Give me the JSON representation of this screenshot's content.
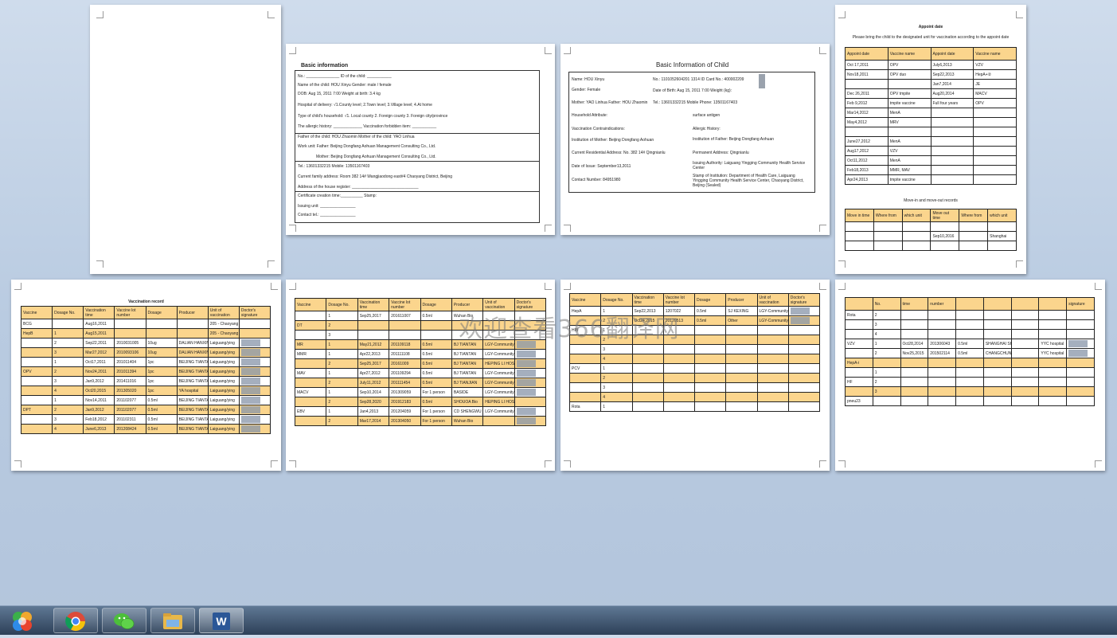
{
  "watermark": "欢迎查看366翻译网",
  "page2": {
    "title": "Basic information",
    "lines": [
      "No.: _______________            ID of the child: ___________",
      "Name of the child:  HOU Xinyu        Gender: male / female",
      "DOB: Aug 15, 2011    7:00             Weight at birth: 3.4 kg",
      "Hospital of delivery: √1.County level; 2.Town level; 3.Village level; 4.At home",
      "Type of child's household: √1. Local county 2. Foreign county 3. Foreign city/province",
      "The allergic history: _____________   Vaccination forbidden item: ___________",
      "Father of the child: HOU Zhaomin            Mother of the child: YAO Linhua",
      "Work unit: Father: Beijing Dongfang Aohuan Management Consulting Co., Ltd.",
      "Mother: Beijing Dongfang Aohuan Management Consulting Co., Ltd.",
      "Tel.: 13601332215                Mobile: 13501167403",
      "Current family address: Room 382 14# Wangjiaodong east#4 Chaoyang District, Beijing",
      "Address of the house register: ______________________________",
      "Certificate creation time:__________          Stamp:",
      "Issuing unit: ________________",
      "Contact tel.: ________________"
    ]
  },
  "page3": {
    "title": "Basic Information of Child",
    "lines_left": [
      "Name: HOU Xinyu",
      "Gender: Female",
      "Mother: YAO Linhua        Father: HOU Zhaomin",
      "Household Attribute:",
      "Vaccination Contraindications:",
      "Institution of Mother: Beijing Dongfang Aohuan",
      "Current Residential Address: No. 382 14# Qingnianlu",
      "Date of Issue: September13,2011",
      "Contact Number: 84951980"
    ],
    "lines_right": [
      "No.: 1101052604201 1314          ID Card No.:  400002209",
      "Date of Birth: Aug 15, 2011   7:00      Weight (kg):",
      "Tel.: 13601332215                 Mobile Phone: 13501167403",
      "surface antigen",
      "Allergic History:",
      "Institution of Father: Beijing Dongfang Aohuan",
      "Permanent Address: Qingnianlu",
      "Issuing Authority: Laiguang Yingging Community Health Service Center",
      "Stamp of Institution: Department of Health Care, Laiguang Yingging Community Health Service Center, Chaoyang District, Beijing (Sealed)"
    ]
  },
  "page4": {
    "title": "Appoint date",
    "subtitle": "Please bring the child to the designated unit for vaccination according to the appoint date",
    "headers": [
      "Appoint date",
      "Vaccine name",
      "Appoint date",
      "Vaccine name"
    ],
    "rows": [
      [
        "Oct 17,2011",
        "OPV",
        "July6,2013",
        "VZV"
      ],
      [
        "Nov18,2011",
        "OPV duo",
        "Sep22,2013",
        "HepA+②"
      ],
      [
        "",
        "",
        "Jan7,2014",
        "JE"
      ],
      [
        "Dec 26,2011",
        "OPV tmpite",
        "Aug20,2014",
        "MACV"
      ],
      [
        "Feb 9,2012",
        "tmpite vaccine",
        "Full four years",
        "OPV"
      ],
      [
        "Mar14,2012",
        "MenA",
        "",
        ""
      ],
      [
        "May4,2012",
        "MRV",
        "",
        ""
      ],
      [
        "",
        "",
        "",
        ""
      ],
      [
        "June27,2012",
        "MenA",
        "",
        ""
      ],
      [
        "Aug17,2012",
        "VZV",
        "",
        ""
      ],
      [
        "Oct11,2012",
        "MenA",
        "",
        ""
      ],
      [
        "Feb18,2013",
        "MMR, MAV",
        "",
        ""
      ],
      [
        "Apr24,2013",
        "tmpite vaccine",
        "",
        ""
      ]
    ],
    "move_title": "Move-in and move-out records",
    "move_headers": [
      "Move in time",
      "Where from",
      "which unit",
      "Move out time",
      "Where from",
      "which unit"
    ],
    "move_rows": [
      [
        "",
        "",
        "",
        "",
        "",
        ""
      ],
      [
        "",
        "",
        "",
        "Sep10,2016",
        "",
        "Shanghai"
      ],
      [
        "",
        "",
        "",
        "",
        "",
        ""
      ]
    ]
  },
  "page5": {
    "title": "Vaccination record",
    "headers": [
      "Vaccine",
      "Dosage No.",
      "Vaccination time",
      "Vaccine lot number",
      "Dosage",
      "Producer",
      "Unit of vaccination",
      "Doctor's signature"
    ],
    "rows": [
      [
        "BCG",
        "",
        "Aug16,2011",
        "",
        "",
        "",
        "205 - Chaoyang",
        "",
        ""
      ],
      [
        "HepB",
        "1",
        "Aug15,2011",
        "",
        "",
        "",
        "205 - Chaoyang",
        "",
        "hl"
      ],
      [
        "",
        "2",
        "Sep22,2011",
        "2010031005",
        "10ug",
        "DALIAN HANXIN",
        "Laiguang/ying",
        "sig",
        ""
      ],
      [
        "",
        "3",
        "Mar27,2012",
        "2010093106",
        "10ug",
        "DALIAN HANXIN",
        "Laiguang/ying",
        "sig",
        "hl"
      ],
      [
        "",
        "1",
        "Oct17,2011",
        "201011404",
        "1pc",
        "BEIJING TIANTAN",
        "Laiguang/ying",
        "sig",
        ""
      ],
      [
        "OPV",
        "2",
        "Nov24,2011",
        "201011394",
        "1pc",
        "BEIJING TIANTAN",
        "Laiguang/ying",
        "sig",
        "hl"
      ],
      [
        "",
        "3",
        "Jan9,2012",
        "201411016",
        "1pc",
        "BEIJING TIANTAN",
        "Laiguang/ying",
        "sig",
        ""
      ],
      [
        "",
        "4",
        "Oct20,2015",
        "201305020",
        "1pc",
        "YA hospital",
        "Laiguang/ying",
        "sig",
        "hl"
      ],
      [
        "",
        "1",
        "Nov14,2011",
        "201102077",
        "0.5ml",
        "BEIJING TIANTAN",
        "Laiguang/ying",
        "sig",
        ""
      ],
      [
        "DPT",
        "2",
        "Jan9,2012",
        "201102077",
        "0.5ml",
        "BEIJING TIANTAN",
        "Laiguang/ying",
        "sig",
        "hl"
      ],
      [
        "",
        "3",
        "Feb18,2012",
        "201102311",
        "0.5ml",
        "BEIJING TIANTAN",
        "Laiguang/ying",
        "sig",
        ""
      ],
      [
        "",
        "4",
        "June6,2013",
        "201208424",
        "0.5ml",
        "BEIJING TIANTAN",
        "Laiguang/ying",
        "sig",
        "hl"
      ]
    ]
  },
  "page6": {
    "headers": [
      "Vaccine",
      "Dosage No.",
      "Vaccination time",
      "Vaccine lot number",
      "Dosage",
      "Producer",
      "Unit of vaccination",
      "Doctor's signature"
    ],
    "rows": [
      [
        "",
        "1",
        "Sep25,2017",
        "201611007",
        "0.5ml",
        "Wuhan Bio",
        "",
        "",
        ""
      ],
      [
        "DT",
        "2",
        "",
        "",
        "",
        "",
        "",
        "",
        "hl"
      ],
      [
        "",
        "3",
        "",
        "",
        "",
        "",
        "",
        "",
        ""
      ],
      [
        "MR",
        "1",
        "May21,2012",
        "201109118",
        "0.5ml",
        "BJ TIANTAN",
        "LGY-Community",
        "sig",
        "hl"
      ],
      [
        "MMR",
        "1",
        "Apr22,2013",
        "201111108",
        "0.5ml",
        "BJ TIANTAN",
        "LGY-Community",
        "sig",
        ""
      ],
      [
        "",
        "2",
        "Sep25,2017",
        "20161009",
        "0.5ml",
        "BJ TIANTAN",
        "HEPING LI HOSPITAL",
        "sig",
        "hl"
      ],
      [
        "MAV",
        "1",
        "Apr27,2012",
        "201109294",
        "0.5ml",
        "BJ TIANTAN",
        "LGY-Community",
        "sig",
        ""
      ],
      [
        "",
        "2",
        "July11,2012",
        "201111454",
        "0.5ml",
        "BJ TIANJIAN",
        "LGY-Community",
        "sig",
        "hl"
      ],
      [
        "MACV",
        "1",
        "Sep10,2014",
        "201309059",
        "For 1 person",
        "BASIDE",
        "LGY-Community",
        "sig",
        ""
      ],
      [
        "",
        "2",
        "Sep28,2020",
        "201912183",
        "0.5ml",
        "SHOUOA Bio",
        "HEPING LI HOSPITAL",
        "",
        "hl"
      ],
      [
        "EBV",
        "1",
        "Jan4,2013",
        "201204059",
        "For 1 person",
        "CD SHENGWU",
        "LGY-Community",
        "sig",
        ""
      ],
      [
        "",
        "2",
        "Mar17,2014",
        "201304050",
        "For 1 person",
        "Wuhan Bio",
        "",
        "sig",
        "hl"
      ]
    ]
  },
  "page7": {
    "headers": [
      "Vaccine",
      "Dosage No.",
      "Vaccination time",
      "Vaccine lot number",
      "Dosage",
      "Producer",
      "Unit of vaccination",
      "Doctor's signature"
    ],
    "rows": [
      [
        "HepA",
        "1",
        "Sep22,2013",
        "1207022",
        "0.5ml",
        "SJ KEXING",
        "LGY-Community",
        "sig",
        ""
      ],
      [
        "",
        "2",
        "Oct24,2015",
        "20120513",
        "0.5ml",
        "Other",
        "LGY-Community",
        "sig",
        "hl"
      ],
      [
        "HIB",
        "1",
        "",
        "",
        "",
        "",
        "",
        "",
        ""
      ],
      [
        "",
        "2",
        "",
        "",
        "",
        "",
        "",
        "",
        "hl"
      ],
      [
        "",
        "3",
        "",
        "",
        "",
        "",
        "",
        "",
        ""
      ],
      [
        "",
        "4",
        "",
        "",
        "",
        "",
        "",
        "",
        "hl"
      ],
      [
        "PCV",
        "1",
        "",
        "",
        "",
        "",
        "",
        "",
        ""
      ],
      [
        "",
        "2",
        "",
        "",
        "",
        "",
        "",
        "",
        "hl"
      ],
      [
        "",
        "3",
        "",
        "",
        "",
        "",
        "",
        "",
        ""
      ],
      [
        "",
        "4",
        "",
        "",
        "",
        "",
        "",
        "",
        "hl"
      ],
      [
        "Rota",
        "1",
        "",
        "",
        "",
        "",
        "",
        "",
        ""
      ]
    ]
  },
  "page8": {
    "headers": [
      "",
      "No.",
      "time",
      "number",
      "",
      "",
      "",
      "",
      "signature"
    ],
    "rows": [
      [
        "Rota",
        "2",
        "",
        "",
        "",
        "",
        "",
        "",
        "",
        ""
      ],
      [
        "",
        "3",
        "",
        "",
        "",
        "",
        "",
        "",
        "",
        ""
      ],
      [
        "",
        "4",
        "",
        "",
        "",
        "",
        "",
        "",
        "",
        ""
      ],
      [
        "VZV",
        "1",
        "Oct28,2014",
        "201306043",
        "0.5ml",
        "SHANGHAI SHENGWU",
        "",
        "YYC hospital",
        "sig",
        ""
      ],
      [
        "",
        "2",
        "Nov25,2015",
        "201502114",
        "0.5ml",
        "CHANGCHUN BAIKE",
        "",
        "YYC hospital",
        "sig",
        ""
      ],
      [
        "HepA-i",
        "",
        "",
        "",
        "",
        "",
        "",
        "",
        "",
        "hl"
      ],
      [
        "",
        "1",
        "",
        "",
        "",
        "",
        "",
        "",
        "",
        ""
      ],
      [
        "HF",
        "2",
        "",
        "",
        "",
        "",
        "",
        "",
        "",
        ""
      ],
      [
        "",
        "3",
        "",
        "",
        "",
        "",
        "",
        "",
        "",
        "hl"
      ],
      [
        "pneu23",
        "",
        "",
        "",
        "",
        "",
        "",
        "",
        "",
        ""
      ]
    ]
  },
  "taskbar": {
    "items": [
      "start-orb",
      "chrome",
      "wechat",
      "file-explorer",
      "word"
    ]
  }
}
